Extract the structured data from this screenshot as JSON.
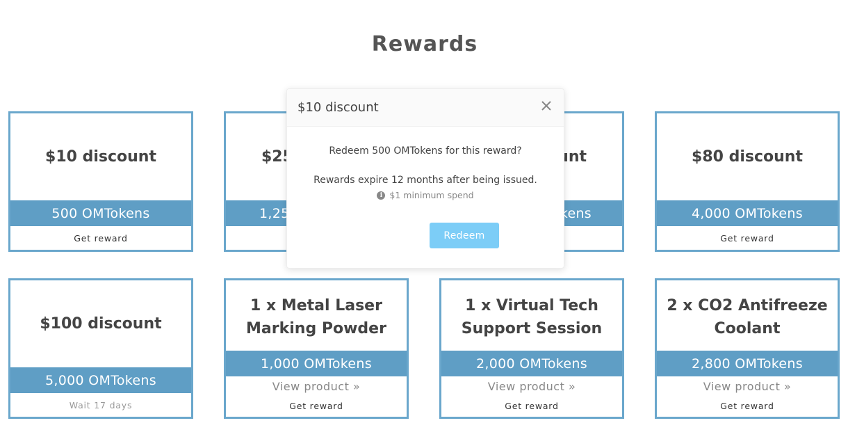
{
  "page": {
    "title": "Rewards"
  },
  "modal": {
    "title": "$10 discount",
    "question": "Redeem 500 OMTokens for this reward?",
    "expiry": "Rewards expire 12 months after being issued.",
    "minimum": "$1 minimum spend",
    "redeem_label": "Redeem"
  },
  "rewards": [
    {
      "title": "$10 discount",
      "price": "500 OMTokens",
      "action": "Get reward"
    },
    {
      "title": "$25",
      "price": "1,25",
      "action": ""
    },
    {
      "title": "unt",
      "price": "kens",
      "action": ""
    },
    {
      "title": "$80 discount",
      "price": "4,000 OMTokens",
      "action": "Get reward"
    },
    {
      "title": "$100 discount",
      "price": "5,000 OMTokens",
      "action": "Wait 17 days"
    },
    {
      "title": "1 x Metal Laser Marking Powder",
      "price": "1,000 OMTokens",
      "link": "View product »",
      "action": "Get reward"
    },
    {
      "title": "1 x Virtual Tech Support Session",
      "price": "2,000 OMTokens",
      "link": "View product »",
      "action": "Get reward"
    },
    {
      "title": "2 x CO2 Antifreeze Coolant",
      "price": "2,800 OMTokens",
      "link": "View product »",
      "action": "Get reward"
    }
  ]
}
